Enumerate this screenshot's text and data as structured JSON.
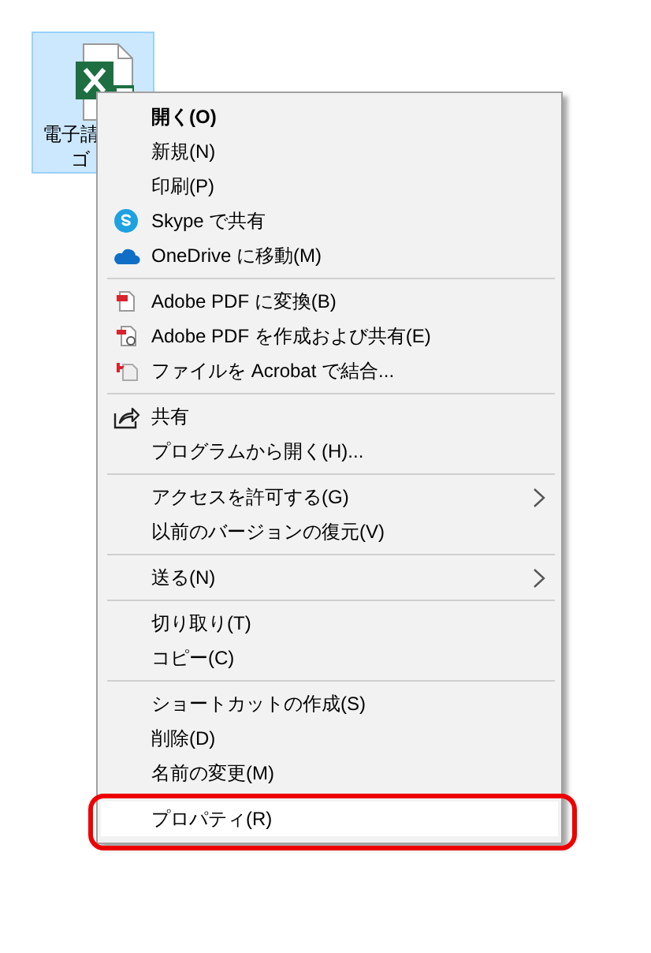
{
  "desktop_icon": {
    "label_lines": [
      "電子請",
      "ゴ"
    ],
    "selected": true
  },
  "context_menu": {
    "items": [
      {
        "kind": "plain",
        "label": "開く(O)",
        "default": true,
        "selected": false
      },
      {
        "kind": "plain",
        "label": "新規(N)",
        "selected": false
      },
      {
        "kind": "plain",
        "label": "印刷(P)",
        "selected": false
      },
      {
        "kind": "skype",
        "label": "Skype で共有",
        "selected": false
      },
      {
        "kind": "cloud",
        "label": "OneDrive に移動(M)",
        "selected": false
      },
      {
        "kind": "separator"
      },
      {
        "kind": "pdfconvert",
        "label": "Adobe PDF に変換(B)",
        "selected": false
      },
      {
        "kind": "pdfshare",
        "label": "Adobe PDF を作成および共有(E)",
        "selected": false
      },
      {
        "kind": "pdfcombine",
        "label": "ファイルを Acrobat で結合...",
        "selected": false
      },
      {
        "kind": "separator"
      },
      {
        "kind": "share",
        "label": "共有",
        "selected": false
      },
      {
        "kind": "plain",
        "label": "プログラムから開く(H)...",
        "selected": false
      },
      {
        "kind": "separator"
      },
      {
        "kind": "plain",
        "label": "アクセスを許可する(G)",
        "submenu": true,
        "selected": false
      },
      {
        "kind": "plain",
        "label": "以前のバージョンの復元(V)",
        "selected": false
      },
      {
        "kind": "separator"
      },
      {
        "kind": "plain",
        "label": "送る(N)",
        "submenu": true,
        "selected": false
      },
      {
        "kind": "separator"
      },
      {
        "kind": "plain",
        "label": "切り取り(T)",
        "selected": false
      },
      {
        "kind": "plain",
        "label": "コピー(C)",
        "selected": false
      },
      {
        "kind": "separator"
      },
      {
        "kind": "plain",
        "label": "ショートカットの作成(S)",
        "selected": false
      },
      {
        "kind": "plain",
        "label": "削除(D)",
        "selected": false
      },
      {
        "kind": "plain",
        "label": "名前の変更(M)",
        "selected": false
      },
      {
        "kind": "separator"
      },
      {
        "kind": "plain",
        "label": "プロパティ(R)",
        "selected": true,
        "annotated": true
      }
    ]
  }
}
